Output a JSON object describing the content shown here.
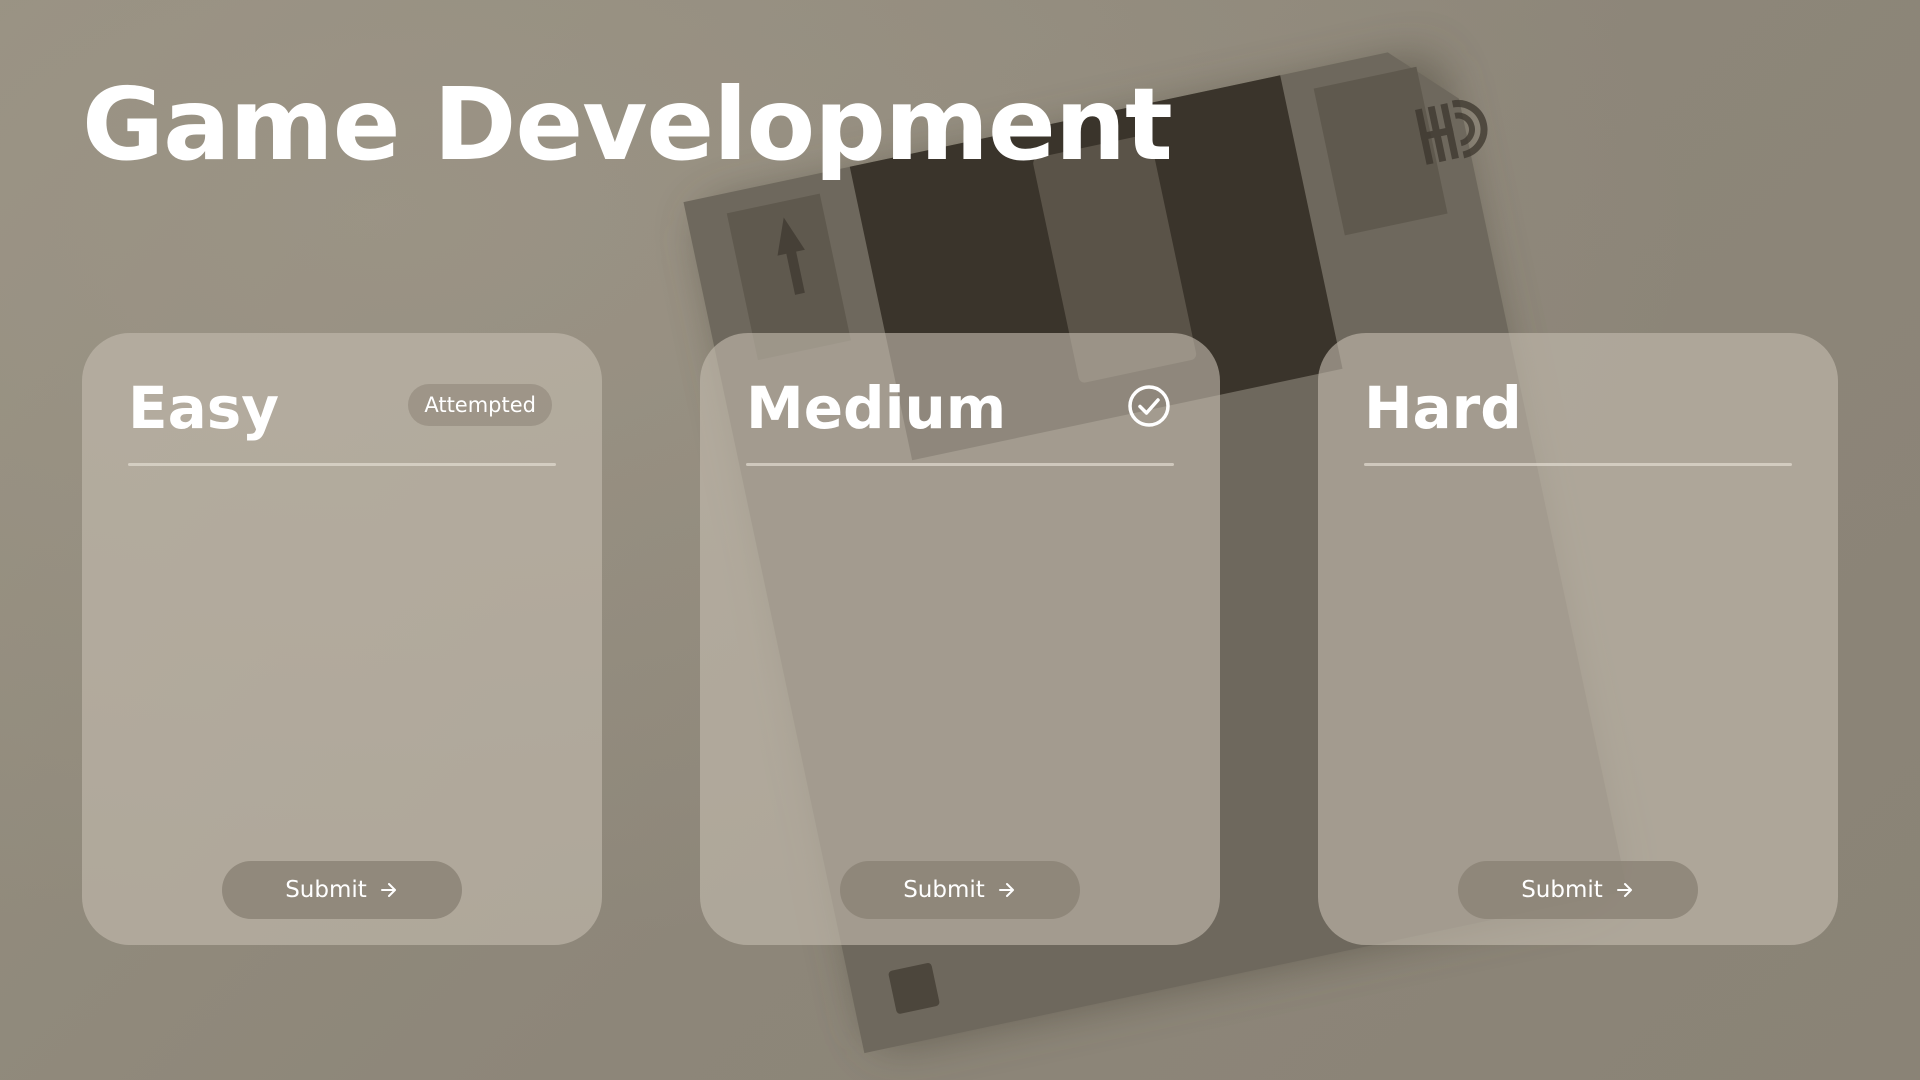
{
  "page": {
    "title": "Game Development"
  },
  "cards": [
    {
      "title": "Easy",
      "badge": "Attempted",
      "submit_label": "Submit",
      "arrow_icon": "arrow-right-icon"
    },
    {
      "title": "Medium",
      "status_icon": "check-circle-icon",
      "submit_label": "Submit",
      "arrow_icon": "arrow-right-icon"
    },
    {
      "title": "Hard",
      "submit_label": "Submit",
      "arrow_icon": "arrow-right-icon"
    }
  ],
  "background": {
    "image": "floppy-disk",
    "disk_logo": "HD"
  },
  "colors": {
    "background": "#8f887b",
    "card": "#c4bcae",
    "button": "#8c8477",
    "text": "#ffffff"
  }
}
